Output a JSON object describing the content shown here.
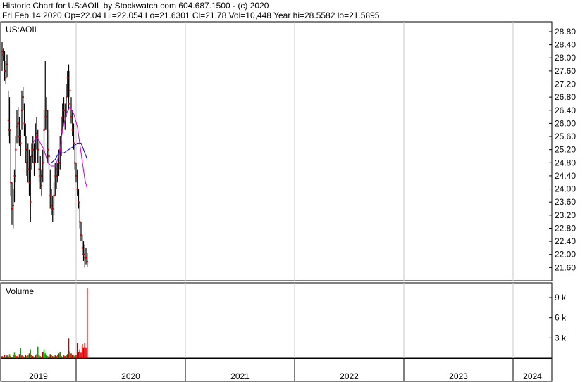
{
  "header": {
    "line1": "Historic Chart for US:AOIL by Stockwatch.com 604.687.1500 - (c) 2020",
    "line2": "Fri Feb 14 2020   Op=22.04   Hi=22.054   Lo=21.6301   Cl=21.78   Vol=10,448   Year hi=28.5582   lo=21.5895"
  },
  "colors": {
    "price_bar": "#000000",
    "close_dot": "#cc0000",
    "ma_short": "#cc00cc",
    "ma_long": "#0000cc",
    "volume_up": "#00aa00",
    "volume_down": "#cc0000",
    "grid": "#c8c8c8"
  },
  "chart_data": [
    {
      "type": "ohlc",
      "title": "US:AOIL",
      "y_ticks": [
        "28.80",
        "28.40",
        "28.00",
        "27.60",
        "27.20",
        "26.80",
        "26.40",
        "26.00",
        "25.60",
        "25.20",
        "24.80",
        "24.40",
        "24.00",
        "23.60",
        "23.20",
        "22.80",
        "22.40",
        "22.00",
        "21.60"
      ],
      "y_tick_values": [
        28.8,
        28.4,
        28.0,
        27.6,
        27.2,
        26.8,
        26.4,
        26.0,
        25.6,
        25.2,
        24.8,
        24.4,
        24.0,
        23.6,
        23.2,
        22.8,
        22.4,
        22.0,
        21.6
      ],
      "ylim": [
        21.2,
        29.1
      ],
      "x_labels": [
        "2019",
        "2020",
        "2021",
        "2022",
        "2023",
        "2024"
      ],
      "grid": true,
      "bars": [
        {
          "h": 28.5,
          "l": 27.6,
          "c": 28.2
        },
        {
          "h": 28.3,
          "l": 27.9,
          "c": 28.1
        },
        {
          "h": 28.2,
          "l": 27.3,
          "c": 27.6
        },
        {
          "h": 27.9,
          "l": 27.2,
          "c": 27.4
        },
        {
          "h": 28.1,
          "l": 27.4,
          "c": 27.8
        },
        {
          "h": 27.0,
          "l": 25.6,
          "c": 26.1
        },
        {
          "h": 26.8,
          "l": 25.4,
          "c": 25.8
        },
        {
          "h": 25.8,
          "l": 23.8,
          "c": 24.2
        },
        {
          "h": 24.2,
          "l": 22.9,
          "c": 23.4
        },
        {
          "h": 24.0,
          "l": 22.8,
          "c": 23.5
        },
        {
          "h": 24.6,
          "l": 23.6,
          "c": 24.4
        },
        {
          "h": 25.6,
          "l": 24.2,
          "c": 25.2
        },
        {
          "h": 26.4,
          "l": 25.4,
          "c": 25.9
        },
        {
          "h": 26.5,
          "l": 25.4,
          "c": 26.0
        },
        {
          "h": 26.2,
          "l": 25.3,
          "c": 25.6
        },
        {
          "h": 25.8,
          "l": 25.0,
          "c": 25.4
        },
        {
          "h": 27.0,
          "l": 25.8,
          "c": 26.4
        },
        {
          "h": 27.1,
          "l": 26.4,
          "c": 26.8
        },
        {
          "h": 26.6,
          "l": 25.6,
          "c": 26.0
        },
        {
          "h": 26.0,
          "l": 24.8,
          "c": 25.2
        },
        {
          "h": 25.6,
          "l": 24.4,
          "c": 24.8
        },
        {
          "h": 25.4,
          "l": 24.2,
          "c": 24.6
        },
        {
          "h": 25.2,
          "l": 23.8,
          "c": 24.2
        },
        {
          "h": 25.0,
          "l": 23.0,
          "c": 23.6
        },
        {
          "h": 25.4,
          "l": 24.6,
          "c": 25.0
        },
        {
          "h": 25.6,
          "l": 24.8,
          "c": 25.2
        },
        {
          "h": 25.4,
          "l": 24.4,
          "c": 24.8
        },
        {
          "h": 26.0,
          "l": 24.8,
          "c": 25.6
        },
        {
          "h": 26.2,
          "l": 25.2,
          "c": 25.7
        },
        {
          "h": 25.8,
          "l": 24.8,
          "c": 25.2
        },
        {
          "h": 25.4,
          "l": 24.2,
          "c": 24.6
        },
        {
          "h": 25.0,
          "l": 24.0,
          "c": 24.4
        },
        {
          "h": 24.6,
          "l": 23.8,
          "c": 24.1
        },
        {
          "h": 25.2,
          "l": 24.2,
          "c": 24.8
        },
        {
          "h": 26.4,
          "l": 24.8,
          "c": 25.8
        },
        {
          "h": 27.9,
          "l": 25.8,
          "c": 26.2
        },
        {
          "h": 26.8,
          "l": 25.8,
          "c": 26.4
        },
        {
          "h": 26.4,
          "l": 24.8,
          "c": 25.2
        },
        {
          "h": 25.8,
          "l": 24.6,
          "c": 25.0
        },
        {
          "h": 24.6,
          "l": 23.4,
          "c": 23.8
        },
        {
          "h": 24.0,
          "l": 23.2,
          "c": 23.5
        },
        {
          "h": 23.8,
          "l": 23.0,
          "c": 23.4
        },
        {
          "h": 24.2,
          "l": 23.2,
          "c": 23.8
        },
        {
          "h": 24.8,
          "l": 23.8,
          "c": 24.4
        },
        {
          "h": 24.8,
          "l": 24.0,
          "c": 24.4
        },
        {
          "h": 24.8,
          "l": 24.2,
          "c": 24.6
        },
        {
          "h": 25.2,
          "l": 24.4,
          "c": 24.8
        },
        {
          "h": 25.6,
          "l": 24.6,
          "c": 25.2
        },
        {
          "h": 26.2,
          "l": 25.0,
          "c": 25.8
        },
        {
          "h": 26.6,
          "l": 25.8,
          "c": 26.2
        },
        {
          "h": 26.8,
          "l": 26.0,
          "c": 26.4
        },
        {
          "h": 26.6,
          "l": 25.8,
          "c": 26.2
        },
        {
          "h": 27.2,
          "l": 26.2,
          "c": 26.8
        },
        {
          "h": 27.6,
          "l": 26.8,
          "c": 27.4
        },
        {
          "h": 27.8,
          "l": 26.4,
          "c": 26.6
        },
        {
          "h": 27.6,
          "l": 26.8,
          "c": 27.0
        },
        {
          "h": 26.8,
          "l": 26.0,
          "c": 26.2
        },
        {
          "h": 26.4,
          "l": 25.6,
          "c": 25.8
        },
        {
          "h": 26.0,
          "l": 25.2,
          "c": 25.4
        },
        {
          "h": 25.4,
          "l": 24.6,
          "c": 24.8
        },
        {
          "h": 24.8,
          "l": 24.2,
          "c": 24.4
        },
        {
          "h": 24.6,
          "l": 23.8,
          "c": 24.0
        },
        {
          "h": 24.0,
          "l": 23.4,
          "c": 23.6
        },
        {
          "h": 23.6,
          "l": 22.8,
          "c": 23.0
        },
        {
          "h": 23.0,
          "l": 22.4,
          "c": 22.6
        },
        {
          "h": 22.6,
          "l": 22.0,
          "c": 22.2
        },
        {
          "h": 22.4,
          "l": 21.8,
          "c": 22.0
        },
        {
          "h": 22.3,
          "l": 21.6,
          "c": 21.9
        },
        {
          "h": 22.2,
          "l": 21.7,
          "c": 21.9
        },
        {
          "h": 22.05,
          "l": 21.63,
          "c": 21.78
        }
      ],
      "ma_short": [
        {
          "i": 25,
          "v": 25.4
        },
        {
          "i": 28,
          "v": 25.6
        },
        {
          "i": 31,
          "v": 25.4
        },
        {
          "i": 34,
          "v": 25.2
        },
        {
          "i": 37,
          "v": 24.8
        },
        {
          "i": 40,
          "v": 24.7
        },
        {
          "i": 43,
          "v": 24.7
        },
        {
          "i": 46,
          "v": 25.0
        },
        {
          "i": 49,
          "v": 25.8
        },
        {
          "i": 52,
          "v": 26.3
        },
        {
          "i": 55,
          "v": 26.5
        },
        {
          "i": 58,
          "v": 26.3
        },
        {
          "i": 61,
          "v": 25.9
        },
        {
          "i": 64,
          "v": 25.1
        },
        {
          "i": 67,
          "v": 24.3
        },
        {
          "i": 69,
          "v": 24.0
        }
      ],
      "ma_long": [
        {
          "i": 40,
          "v": 24.8
        },
        {
          "i": 43,
          "v": 24.9
        },
        {
          "i": 46,
          "v": 25.1
        },
        {
          "i": 50,
          "v": 25.1
        },
        {
          "i": 54,
          "v": 25.2
        },
        {
          "i": 58,
          "v": 25.3
        },
        {
          "i": 61,
          "v": 25.4
        },
        {
          "i": 64,
          "v": 25.4
        },
        {
          "i": 67,
          "v": 25.1
        },
        {
          "i": 69,
          "v": 24.9
        }
      ]
    },
    {
      "type": "bar",
      "title": "Volume",
      "y_ticks": [
        "9 k",
        "6 k",
        "3 k"
      ],
      "y_tick_values": [
        9000,
        6000,
        3000
      ],
      "ylim": [
        0,
        11200
      ],
      "values": [
        300,
        200,
        500,
        150,
        400,
        250,
        600,
        300,
        200,
        500,
        800,
        400,
        300,
        200,
        600,
        1500,
        400,
        300,
        200,
        500,
        300,
        400,
        700,
        1300,
        500,
        300,
        200,
        400,
        600,
        1700,
        500,
        300,
        200,
        900,
        1300,
        700,
        400,
        300,
        200,
        600,
        500,
        300,
        200,
        400,
        300,
        500,
        700,
        900,
        300,
        200,
        400,
        300,
        500,
        600,
        2900,
        1000,
        700,
        500,
        400,
        300,
        500,
        2200,
        900,
        1300,
        800,
        2100,
        1600,
        2300,
        1600,
        10448
      ],
      "up": [
        0,
        1,
        0,
        1,
        0,
        0,
        1,
        0,
        1,
        0,
        1,
        0,
        0,
        1,
        0,
        1,
        0,
        0,
        1,
        0,
        1,
        1,
        0,
        1,
        0,
        0,
        1,
        0,
        1,
        1,
        0,
        1,
        0,
        0,
        1,
        1,
        0,
        1,
        0,
        0,
        1,
        0,
        1,
        0,
        0,
        1,
        0,
        1,
        0,
        1,
        0,
        0,
        1,
        0,
        0,
        1,
        0,
        0,
        1,
        0,
        0,
        0,
        0,
        0,
        0,
        0,
        0,
        0,
        0,
        0
      ]
    }
  ]
}
